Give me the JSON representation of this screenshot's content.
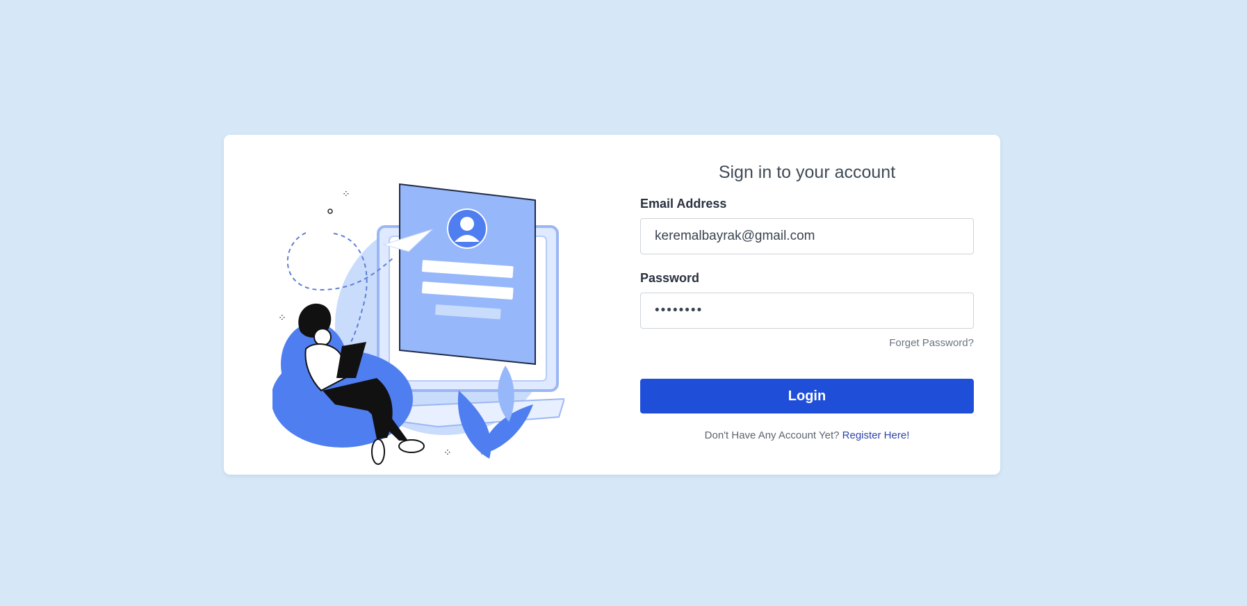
{
  "form": {
    "title": "Sign in to your account",
    "email_label": "Email Address",
    "email_value": "keremalbayrak@gmail.com",
    "password_label": "Password",
    "password_value": "password",
    "forgot_password": "Forget Password?",
    "login_button": "Login",
    "register_prompt": "Don't Have Any Account Yet?",
    "register_link": "Register Here!"
  },
  "illustration": {
    "icons": [
      "person-at-laptop-illustration",
      "user-avatar-icon",
      "paper-plane-icon",
      "leaf-icon",
      "sparkle-icon"
    ]
  },
  "colors": {
    "background": "#d6e8f7",
    "card": "#ffffff",
    "accent": "#1f4fd9",
    "illustration_light": "#c9dcfb",
    "illustration_mid": "#97b7fb",
    "illustration_dark": "#4f7ef0"
  }
}
